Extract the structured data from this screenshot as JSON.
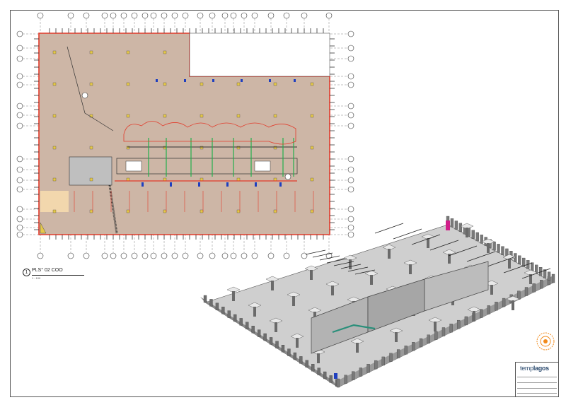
{
  "view": {
    "number": "1",
    "name": "PLS° 02 COO",
    "scale": "1 : 100"
  },
  "titleblock": {
    "logo_prefix": "temp",
    "logo_main": "lagos"
  },
  "colors": {
    "slab_fill": "#cdb6a6",
    "slab_edge": "#e23b2b",
    "pipe_green": "#22b14c",
    "pipe_blue": "#1f3fbf",
    "grid_line": "#333333",
    "stamp_orange": "#f28a1a",
    "accent_magenta": "#d11f8a"
  },
  "icons": {
    "stamp": "sun-seal-icon",
    "grid_bubble": "grid-bubble-icon"
  }
}
